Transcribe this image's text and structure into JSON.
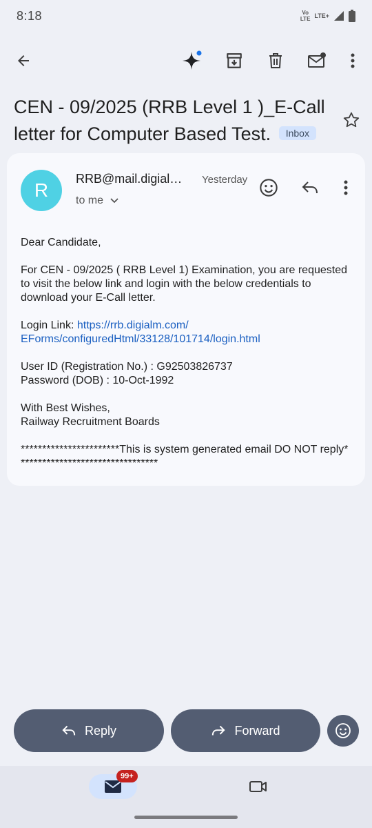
{
  "status": {
    "time": "8:18",
    "volte_top": "Vo",
    "volte_bottom": "LTE",
    "lte": "LTE+"
  },
  "toolbar": {
    "back_icon": "arrow-left-icon",
    "gemini_icon": "sparkle-icon",
    "archive_icon": "archive-icon",
    "delete_icon": "trash-icon",
    "mark_unread_icon": "mail-unread-icon",
    "more_icon": "more-vert-icon"
  },
  "email": {
    "subject": "CEN - 09/2025 (RRB Level 1 )_E-Call letter for Computer Based Test.",
    "label": "Inbox",
    "sender_initial": "R",
    "sender": "RRB@mail.digial…",
    "date": "Yesterday",
    "recipient": "to me",
    "body": {
      "greeting": "Dear Candidate,",
      "intro": "For CEN - 09/2025 ( RRB Level 1) Examination, you are requested to visit the below link and login with the below credentials to download your E-Call letter.",
      "link_label": "Login Link: ",
      "link_line1": "https://rrb.digialm.com/",
      "link_line2": "EForms/configuredHtml/33128/101714/login.html",
      "user_id": "User ID (Registration No.) : G92503826737",
      "password": "Password (DOB) : 10-Oct-1992",
      "closing1": "With Best Wishes,",
      "closing2": "Railway Recruitment Boards",
      "footer": "***********************This is system generated email DO NOT reply*********************************"
    }
  },
  "actions": {
    "reply_label": "Reply",
    "forward_label": "Forward"
  },
  "nav": {
    "mail_badge": "99+"
  },
  "colors": {
    "avatar": "#4fd1e4",
    "button": "#535d72",
    "link": "#1a5fc1",
    "badge": "#c5221f",
    "chip": "#d3e3fd"
  }
}
